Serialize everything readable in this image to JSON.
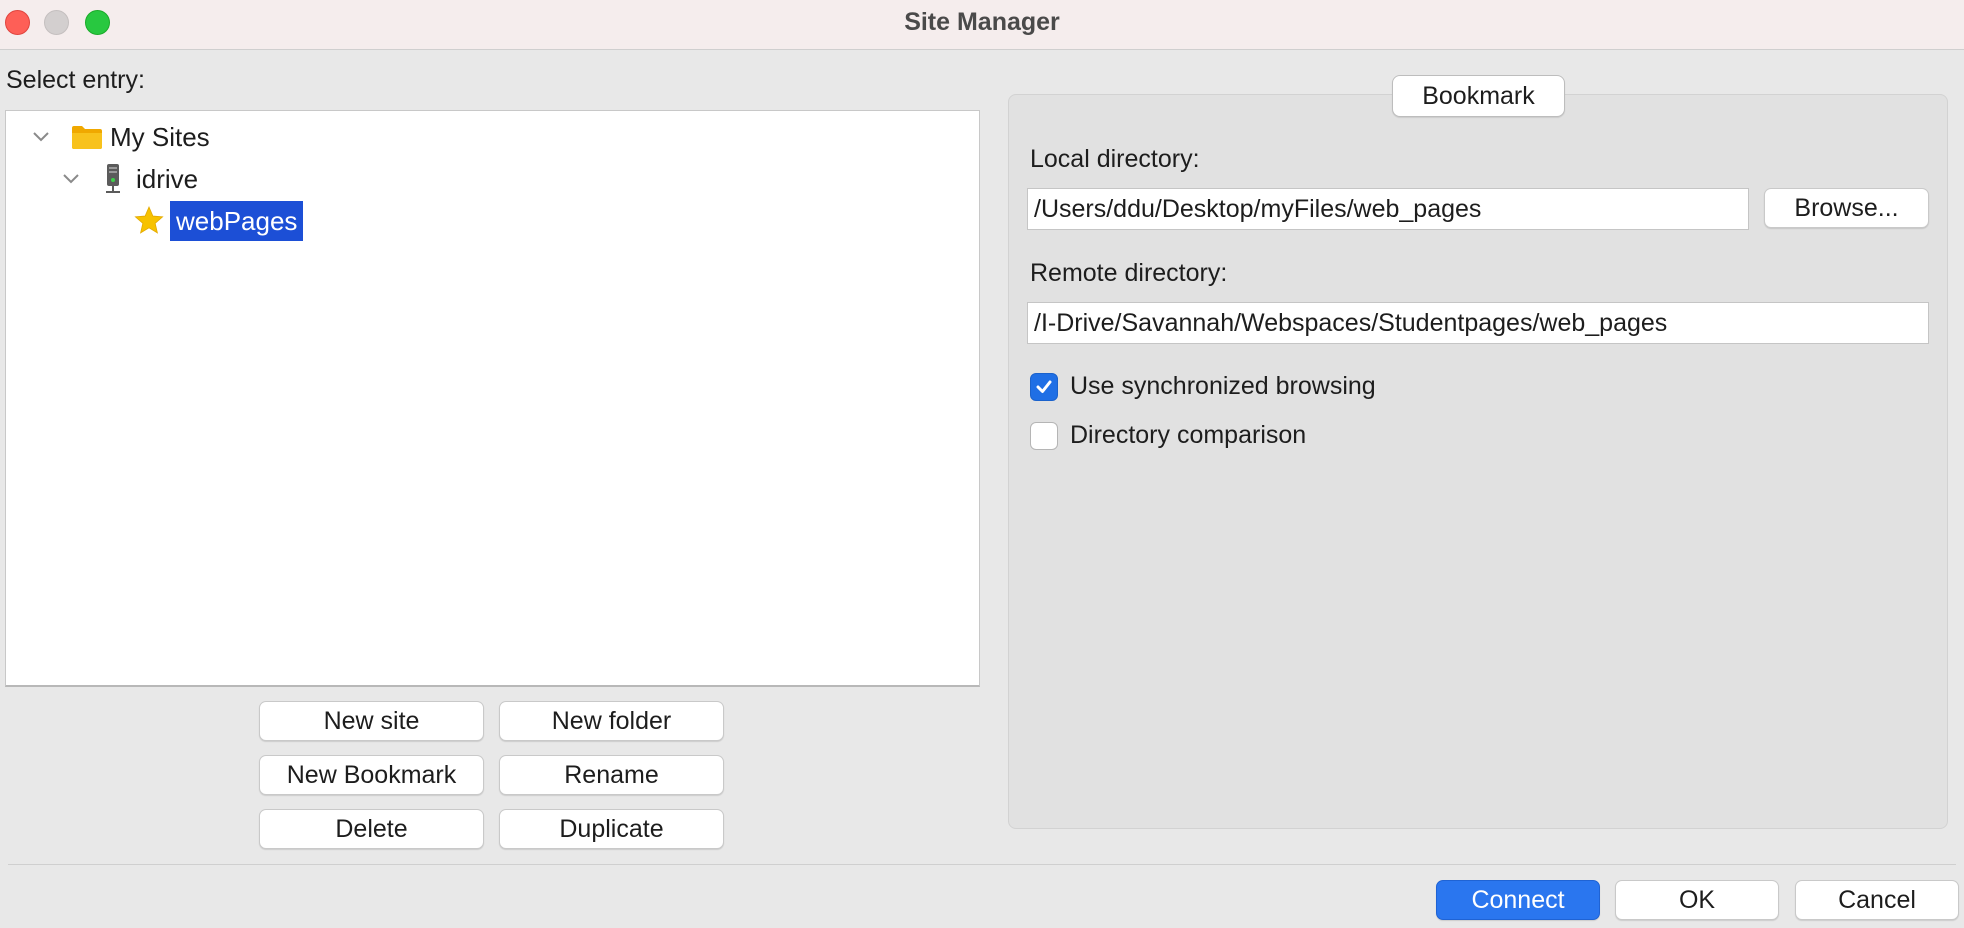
{
  "window": {
    "title": "Site Manager"
  },
  "left": {
    "select_label": "Select entry:",
    "tree": {
      "root": {
        "label": "My Sites",
        "icon": "folder-icon"
      },
      "site": {
        "label": "idrive",
        "icon": "server-icon"
      },
      "bookmark": {
        "label": "webPages",
        "icon": "star-icon",
        "selected": true
      }
    },
    "buttons": {
      "new_site": "New site",
      "new_folder": "New folder",
      "new_bookmark": "New Bookmark",
      "rename": "Rename",
      "delete": "Delete",
      "duplicate": "Duplicate"
    }
  },
  "panel": {
    "tab": "Bookmark",
    "local_label": "Local directory:",
    "local_value": "/Users/ddu/Desktop/myFiles/web_pages",
    "browse": "Browse...",
    "remote_label": "Remote directory:",
    "remote_value": "/I-Drive/Savannah/Webspaces/Studentpages/web_pages",
    "sync_label": "Use synchronized browsing",
    "sync_checked": true,
    "compare_label": "Directory comparison",
    "compare_checked": false
  },
  "footer": {
    "connect": "Connect",
    "ok": "OK",
    "cancel": "Cancel"
  },
  "colors": {
    "accent": "#2a76ef",
    "selection": "#1c4fd6",
    "folder": "#f5b400",
    "star": "#f7c200"
  }
}
